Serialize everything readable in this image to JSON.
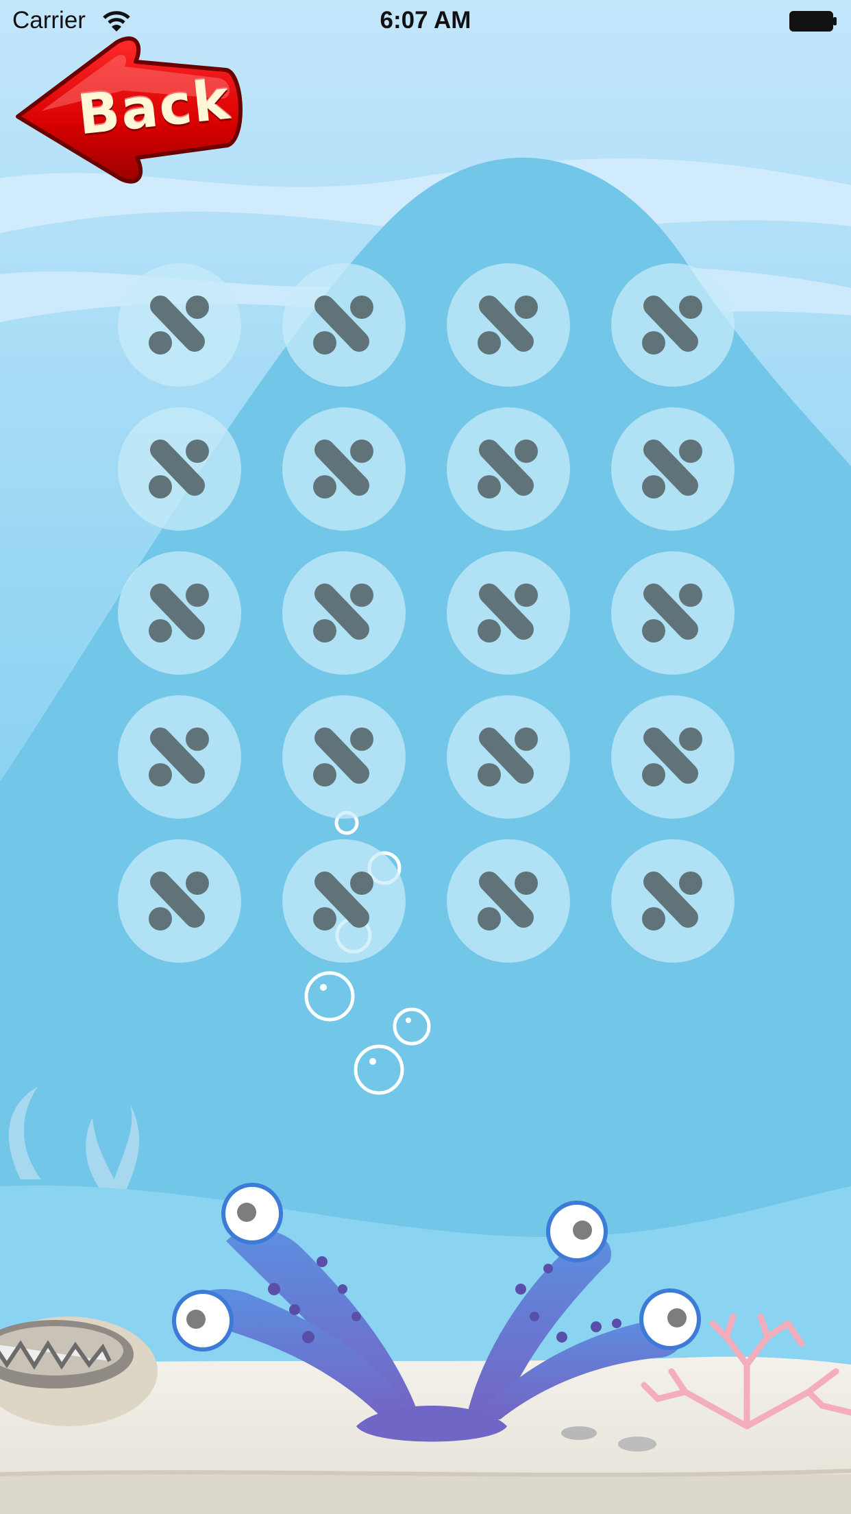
{
  "status_bar": {
    "carrier": "Carrier",
    "time": "6:07 AM"
  },
  "back_button": {
    "label": "Back"
  },
  "level_grid": {
    "rows": 5,
    "columns": 4,
    "cells": [
      {
        "row": 1,
        "col": 1,
        "state": "locked",
        "icon": "locked-icon"
      },
      {
        "row": 1,
        "col": 2,
        "state": "locked",
        "icon": "locked-icon"
      },
      {
        "row": 1,
        "col": 3,
        "state": "locked",
        "icon": "locked-icon"
      },
      {
        "row": 1,
        "col": 4,
        "state": "locked",
        "icon": "locked-icon"
      },
      {
        "row": 2,
        "col": 1,
        "state": "locked",
        "icon": "locked-icon"
      },
      {
        "row": 2,
        "col": 2,
        "state": "locked",
        "icon": "locked-icon"
      },
      {
        "row": 2,
        "col": 3,
        "state": "locked",
        "icon": "locked-icon"
      },
      {
        "row": 2,
        "col": 4,
        "state": "locked",
        "icon": "locked-icon"
      },
      {
        "row": 3,
        "col": 1,
        "state": "locked",
        "icon": "locked-icon"
      },
      {
        "row": 3,
        "col": 2,
        "state": "locked",
        "icon": "locked-icon"
      },
      {
        "row": 3,
        "col": 3,
        "state": "locked",
        "icon": "locked-icon"
      },
      {
        "row": 3,
        "col": 4,
        "state": "locked",
        "icon": "locked-icon"
      },
      {
        "row": 4,
        "col": 1,
        "state": "locked",
        "icon": "locked-icon"
      },
      {
        "row": 4,
        "col": 2,
        "state": "locked",
        "icon": "locked-icon"
      },
      {
        "row": 4,
        "col": 3,
        "state": "locked",
        "icon": "locked-icon"
      },
      {
        "row": 4,
        "col": 4,
        "state": "locked",
        "icon": "locked-icon"
      },
      {
        "row": 5,
        "col": 1,
        "state": "locked",
        "icon": "locked-icon"
      },
      {
        "row": 5,
        "col": 2,
        "state": "locked",
        "icon": "locked-icon"
      },
      {
        "row": 5,
        "col": 3,
        "state": "locked",
        "icon": "locked-icon"
      },
      {
        "row": 5,
        "col": 4,
        "state": "locked",
        "icon": "locked-icon"
      }
    ]
  },
  "colors": {
    "sky_top": "#bfe4fa",
    "water": "#7fd0ef",
    "hill": "#72c6e8",
    "sand": "#efece4",
    "level_bg": "#c8ecf8",
    "locked_icon": "#5f7379",
    "back_red": "#e00000",
    "coral": "#f2a9b4",
    "anemone": "#6e74c8"
  }
}
